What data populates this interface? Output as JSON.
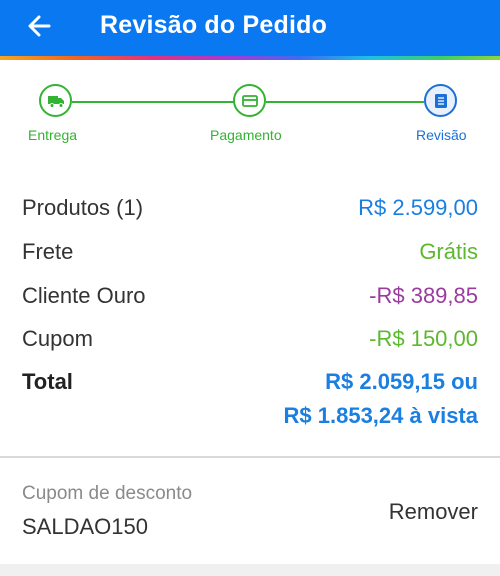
{
  "header": {
    "title": "Revisão do Pedido",
    "back_icon": "arrow-left-icon",
    "background": "#0a78f0"
  },
  "steps": [
    {
      "label": "Entrega",
      "icon": "truck-icon",
      "state": "completed"
    },
    {
      "label": "Pagamento",
      "icon": "credit-card-icon",
      "state": "completed"
    },
    {
      "label": "Revisão",
      "icon": "list-icon",
      "state": "active"
    }
  ],
  "colors": {
    "step_complete": "#34b233",
    "step_active": "#1a6fd8",
    "price_blue": "#1a7fe0",
    "discount_green": "#5cb82e",
    "discount_purple": "#9b3ba0"
  },
  "summary": {
    "products": {
      "label": "Produtos (1)",
      "value": "R$ 2.599,00"
    },
    "shipping": {
      "label": "Frete",
      "value": "Grátis"
    },
    "gold_customer": {
      "label": "Cliente Ouro",
      "value": "-R$ 389,85"
    },
    "coupon": {
      "label": "Cupom",
      "value": "-R$ 150,00"
    },
    "total": {
      "label": "Total",
      "value_line1": "R$ 2.059,15 ou",
      "value_line2": "R$ 1.853,24 à vista"
    }
  },
  "discount_coupon": {
    "label": "Cupom de desconto",
    "code": "SALDAO150",
    "remove_label": "Remover"
  }
}
